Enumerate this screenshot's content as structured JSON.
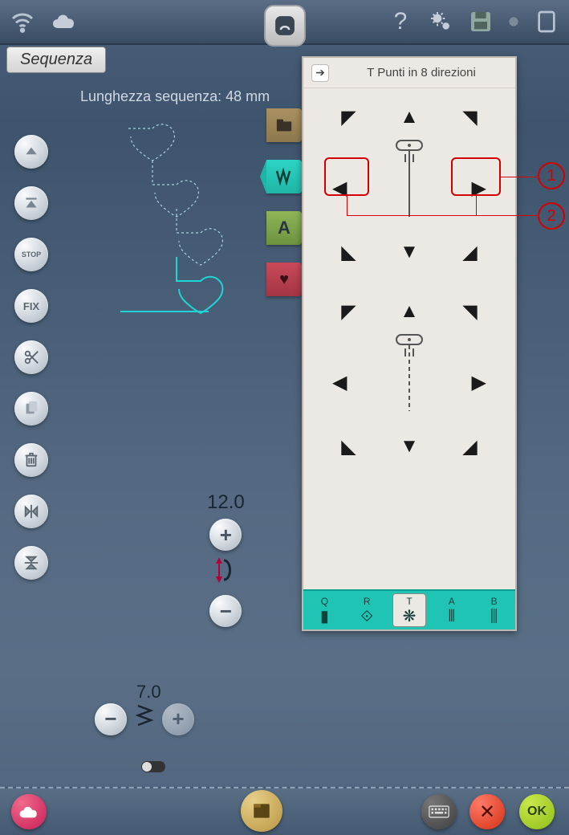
{
  "topbar": {
    "wifi_icon": "wifi",
    "cloud_icon": "cloud",
    "help_label": "?",
    "settings_icon": "gears",
    "save_icon": "save",
    "usb_icon": "usb",
    "screen_icon": "tablet"
  },
  "mode_tab": "Sequenza",
  "sequence_length_label": "Lunghezza sequenza: 48 mm",
  "side_buttons": {
    "up": "▲",
    "top": "⫶",
    "stop": "STOP",
    "fix": "FIX",
    "cut": "cut",
    "copy": "copy",
    "delete": "delete",
    "mirror_h": "mirror-h",
    "mirror_v": "mirror-v"
  },
  "category_tabs": {
    "folder": "folder",
    "zigzag": "≋",
    "letter": "A",
    "heart": "♥"
  },
  "dir_panel": {
    "expand_icon": "➔",
    "title": "T Punti in 8 direzioni"
  },
  "stitch_length": {
    "value": "12.0",
    "plus": "+",
    "minus": "−"
  },
  "stitch_width": {
    "value": "7.0",
    "plus": "+",
    "minus": "−"
  },
  "menu_strip": {
    "items": [
      {
        "letter": "Q",
        "glyph": "▮"
      },
      {
        "letter": "R",
        "glyph": "⟐"
      },
      {
        "letter": "T",
        "glyph": "❋"
      },
      {
        "letter": "A",
        "glyph": "⦀"
      },
      {
        "letter": "B",
        "glyph": "⫼"
      }
    ]
  },
  "footer": {
    "ok_label": "OK",
    "cancel_label": "✕",
    "keyboard_icon": "⌨"
  },
  "callouts": {
    "c1": "1",
    "c2": "2"
  }
}
